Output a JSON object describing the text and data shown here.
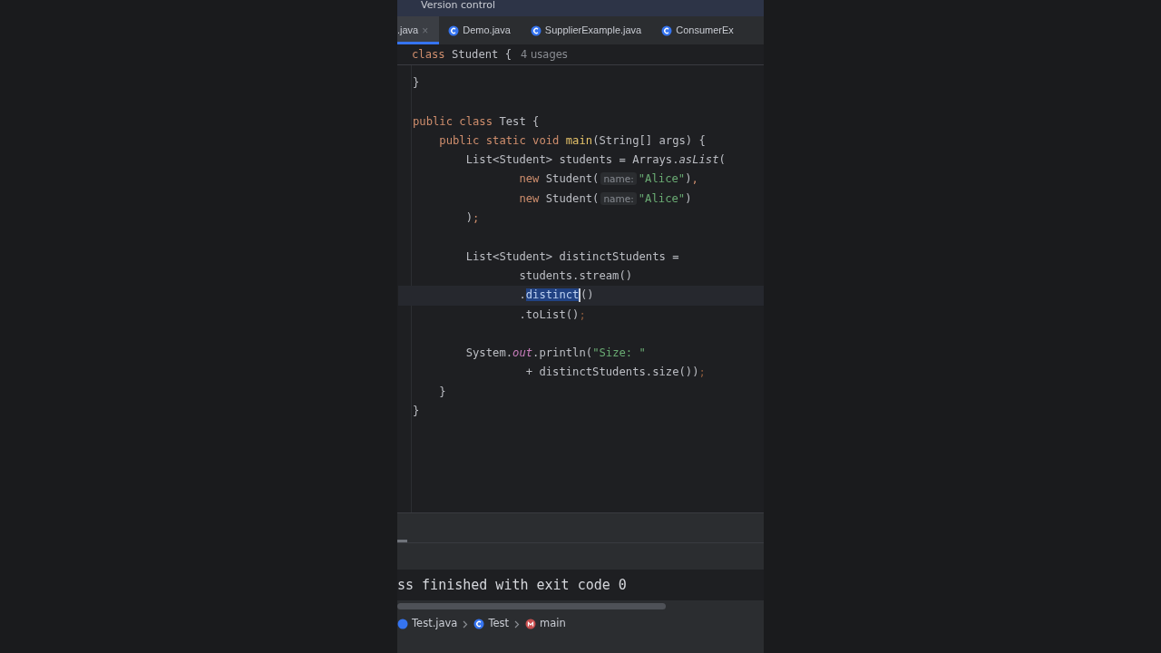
{
  "toolbar": {
    "title": "Version control"
  },
  "tabs": [
    {
      "label": ".java",
      "selected": true,
      "close": "×"
    },
    {
      "label": "Demo.java",
      "selected": false
    },
    {
      "label": "SupplierExample.java",
      "selected": false
    },
    {
      "label": "ConsumerEx",
      "selected": false
    }
  ],
  "sticky_header": {
    "keyword": "class",
    "name": "Student {",
    "usages": "4 usages"
  },
  "code_lines": [
    {
      "kind": "code",
      "current": false,
      "tokens": [
        {
          "text": "}",
          "kind": "plain"
        }
      ]
    },
    {
      "kind": "blank",
      "current": false
    },
    {
      "kind": "code",
      "current": false,
      "tokens": [
        {
          "text": "public class ",
          "kind": "kw"
        },
        {
          "text": "Test {",
          "kind": "plain"
        }
      ]
    },
    {
      "kind": "code",
      "current": false,
      "tokens": [
        {
          "text": "    public static void ",
          "kind": "kw"
        },
        {
          "text": "main",
          "kind": "method"
        },
        {
          "text": "(String[] args) {",
          "kind": "plain"
        }
      ]
    },
    {
      "kind": "code",
      "current": false,
      "tokens": [
        {
          "text": "        List<Student> students = Arrays.",
          "kind": "plain"
        },
        {
          "text": "asList",
          "kind": "italic"
        },
        {
          "text": "(",
          "kind": "plain"
        }
      ]
    },
    {
      "kind": "code",
      "current": false,
      "tokens": [
        {
          "text": "                new ",
          "kind": "kw"
        },
        {
          "text": "Student(",
          "kind": "plain"
        },
        {
          "text": "name:",
          "kind": "hint"
        },
        {
          "text": "\"Alice\"",
          "kind": "str"
        },
        {
          "text": ")",
          "kind": "plain"
        },
        {
          "text": ",",
          "kind": "kw"
        }
      ]
    },
    {
      "kind": "code",
      "current": false,
      "tokens": [
        {
          "text": "                new ",
          "kind": "kw"
        },
        {
          "text": "Student(",
          "kind": "plain"
        },
        {
          "text": "name:",
          "kind": "hint"
        },
        {
          "text": "\"Alice\"",
          "kind": "str"
        },
        {
          "text": ")",
          "kind": "plain"
        }
      ]
    },
    {
      "kind": "code",
      "current": false,
      "tokens": [
        {
          "text": "        )",
          "kind": "plain"
        },
        {
          "text": ";",
          "kind": "kw"
        }
      ]
    },
    {
      "kind": "blank",
      "current": false
    },
    {
      "kind": "code",
      "current": false,
      "tokens": [
        {
          "text": "        List<Student> distinctStudents =",
          "kind": "plain"
        }
      ]
    },
    {
      "kind": "code",
      "current": false,
      "tokens": [
        {
          "text": "                students.stream()",
          "kind": "plain"
        }
      ]
    },
    {
      "kind": "code",
      "current": true,
      "tokens": [
        {
          "text": "                .",
          "kind": "plain"
        },
        {
          "text": "distinct",
          "kind": "sel"
        },
        {
          "text": "()",
          "kind": "plain"
        }
      ]
    },
    {
      "kind": "code",
      "current": false,
      "tokens": [
        {
          "text": "                .toList()",
          "kind": "plain"
        },
        {
          "text": ";",
          "kind": "semi"
        }
      ]
    },
    {
      "kind": "blank",
      "current": false
    },
    {
      "kind": "code",
      "current": false,
      "tokens": [
        {
          "text": "        System.",
          "kind": "plain"
        },
        {
          "text": "out",
          "kind": "field"
        },
        {
          "text": ".println(",
          "kind": "plain"
        },
        {
          "text": "\"Size: \"",
          "kind": "str"
        }
      ]
    },
    {
      "kind": "code",
      "current": false,
      "tokens": [
        {
          "text": "                 + distinctStudents.size())",
          "kind": "plain"
        },
        {
          "text": ";",
          "kind": "semi"
        }
      ]
    },
    {
      "kind": "code",
      "current": false,
      "tokens": [
        {
          "text": "    }",
          "kind": "plain"
        }
      ]
    },
    {
      "kind": "code",
      "current": false,
      "tokens": [
        {
          "text": "}",
          "kind": "plain"
        }
      ]
    }
  ],
  "console": {
    "output": "ss finished with exit code 0"
  },
  "breadcrumbs": [
    {
      "label": "Test.java",
      "kind": "file"
    },
    {
      "label": "Test",
      "kind": "class"
    },
    {
      "label": "main",
      "kind": "method"
    }
  ]
}
